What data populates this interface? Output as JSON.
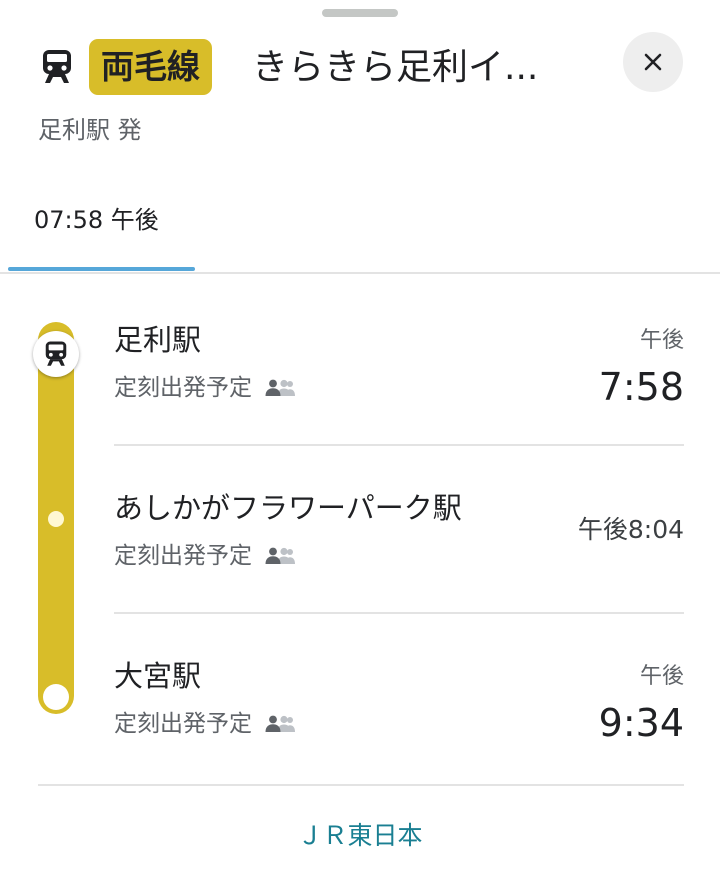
{
  "header": {
    "line_name": "両毛線",
    "route_title": "きらきら足利イ...",
    "subtitle": "足利駅 発",
    "close_label": "✕"
  },
  "tabs": [
    {
      "label": "07:58 午後",
      "selected": true
    }
  ],
  "stops": [
    {
      "name": "足利駅",
      "status": "定刻出発予定",
      "time_prefix": "午後",
      "time": "7:58"
    },
    {
      "name": "あしかがフラワーパーク駅",
      "status": "定刻出発予定",
      "time": "午後8:04"
    },
    {
      "name": "大宮駅",
      "status": "定刻出発予定",
      "time_prefix": "午後",
      "time": "9:34"
    }
  ],
  "operator": "ＪＲ東日本",
  "colors": {
    "line": "#d8bd29",
    "tab_indicator": "#56a7d9",
    "operator_link": "#1a7f92"
  },
  "icons": {
    "train": "train-icon",
    "close": "close-icon",
    "crowd": "crowd-icon"
  }
}
